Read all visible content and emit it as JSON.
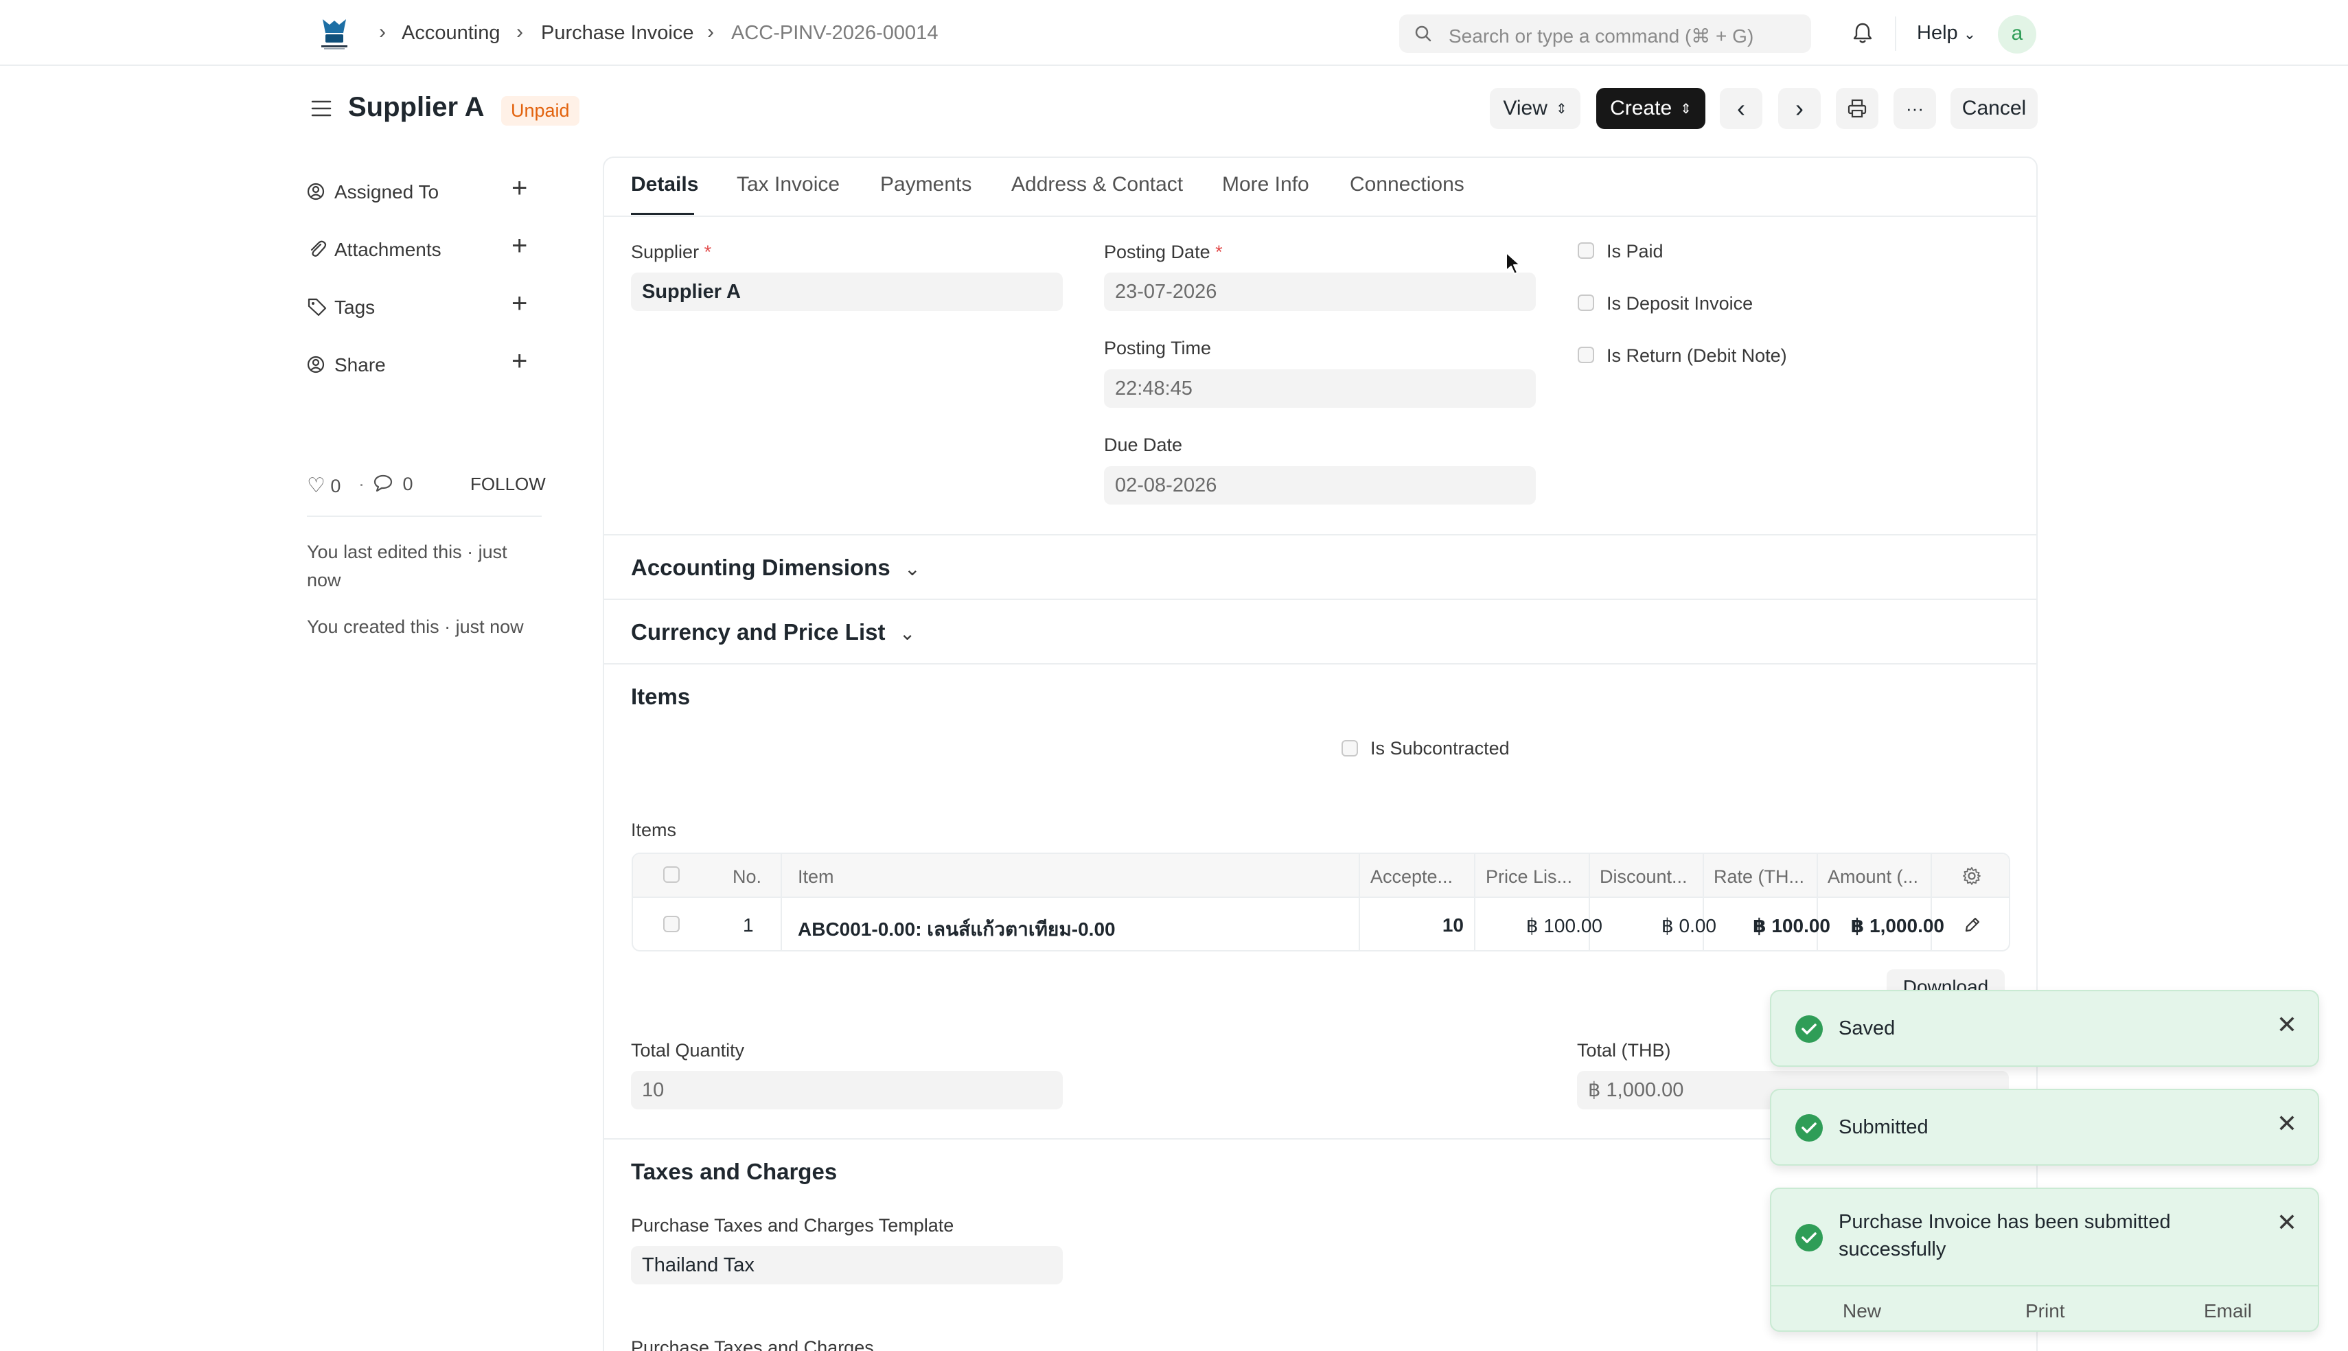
{
  "breadcrumbs": {
    "module": "Accounting",
    "doctype": "Purchase Invoice",
    "docname": "ACC-PINV-2026-00014"
  },
  "search": {
    "placeholder": "Search or type a command (⌘ + G)"
  },
  "header": {
    "help_label": "Help",
    "avatar_letter": "a"
  },
  "page": {
    "title": "Supplier A",
    "status": "Unpaid",
    "status_color": "#e2620d",
    "view_label": "View",
    "create_label": "Create",
    "cancel_label": "Cancel",
    "more_label": "···"
  },
  "sidebar": {
    "items": [
      {
        "label": "Assigned To",
        "icon": "assign-icon"
      },
      {
        "label": "Attachments",
        "icon": "paperclip-icon"
      },
      {
        "label": "Tags",
        "icon": "tag-icon"
      },
      {
        "label": "Share",
        "icon": "share-icon"
      }
    ],
    "likes": "0",
    "comments": "0",
    "follow_label": "FOLLOW",
    "activity_edit": "You last edited this · just now",
    "activity_created": "You created this · just now"
  },
  "tabs": [
    "Details",
    "Tax Invoice",
    "Payments",
    "Address & Contact",
    "More Info",
    "Connections"
  ],
  "details": {
    "supplier_label": "Supplier",
    "supplier_value": "Supplier A",
    "posting_date_label": "Posting Date",
    "posting_date_value": "23-07-2026",
    "posting_time_label": "Posting Time",
    "posting_time_value": "22:48:45",
    "due_date_label": "Due Date",
    "due_date_value": "02-08-2026",
    "is_paid_label": "Is Paid",
    "is_deposit_label": "Is Deposit Invoice",
    "is_return_label": "Is Return (Debit Note)"
  },
  "sections": {
    "accounting_dimensions": "Accounting Dimensions",
    "currency_price_list": "Currency and Price List",
    "items": "Items",
    "is_subcontracted": "Is Subcontracted",
    "items_table_label": "Items",
    "taxes": "Taxes and Charges",
    "taxes_template_label": "Purchase Taxes and Charges Template",
    "taxes_template_value": "Thailand Tax",
    "taxes_table_label": "Purchase Taxes and Charges"
  },
  "items_table": {
    "columns": [
      "No.",
      "Item",
      "Accepte...",
      "Price Lis...",
      "Discount...",
      "Rate (TH...",
      "Amount (..."
    ],
    "rows": [
      {
        "no": "1",
        "item": "ABC001-0.00: เลนส์แก้วตาเทียม-0.00",
        "qty": "10",
        "price_list": "฿ 100.00",
        "discount": "฿ 0.00",
        "rate": "฿ 100.00",
        "amount": "฿ 1,000.00"
      }
    ],
    "download_label": "Download"
  },
  "totals": {
    "total_qty_label": "Total Quantity",
    "total_qty_value": "10",
    "total_label": "Total (THB)",
    "total_value": "฿ 1,000.00"
  },
  "toasts": [
    {
      "message": "Saved"
    },
    {
      "message": "Submitted"
    },
    {
      "message_line1": "Purchase Invoice has been submitted",
      "message_line2": "successfully",
      "actions": [
        "New",
        "Print",
        "Email"
      ]
    }
  ],
  "colors": {
    "success": "#2f9d57",
    "toast_bg": "#e4f5ea",
    "primary_button": "#171717"
  }
}
